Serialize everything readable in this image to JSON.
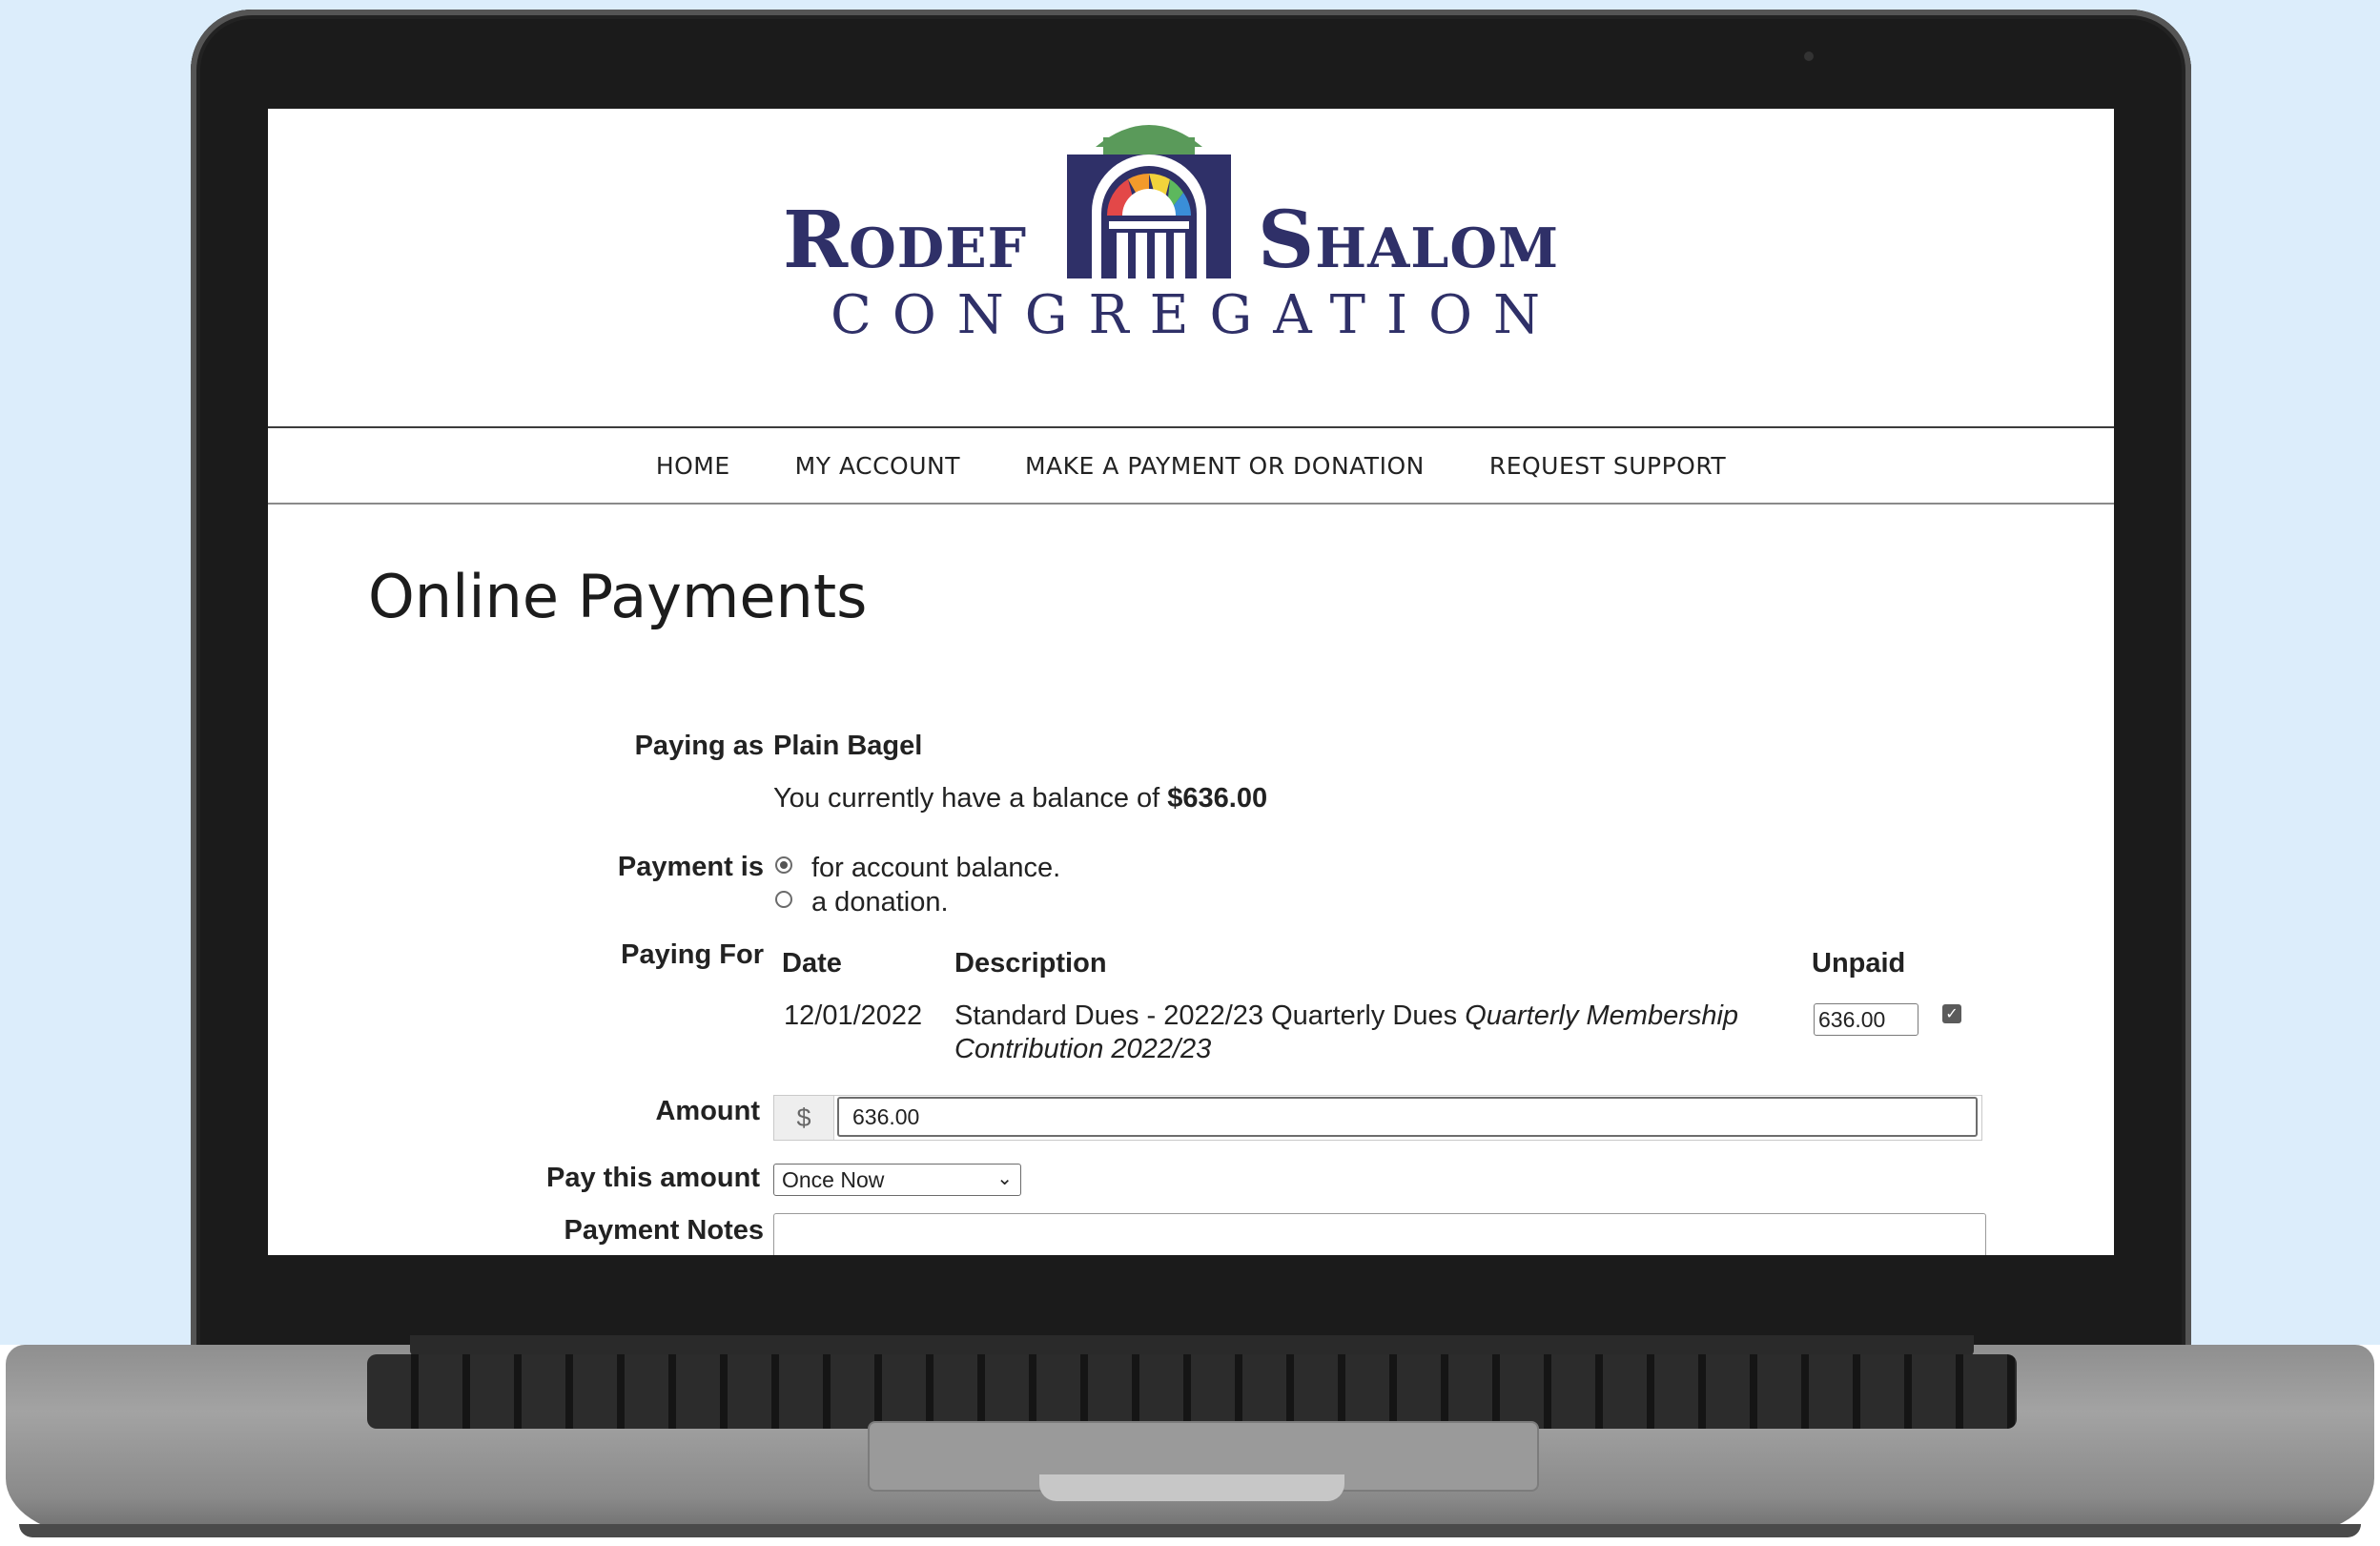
{
  "site": {
    "logo_left": "Rodef",
    "logo_right": "Shalom",
    "logo_sub": "Congregation",
    "colors": {
      "brand_navy": "#2f3068",
      "brand_green": "#5a9a5a"
    }
  },
  "nav": {
    "items": [
      "HOME",
      "MY ACCOUNT",
      "MAKE A PAYMENT OR DONATION",
      "REQUEST SUPPORT"
    ]
  },
  "page": {
    "title": "Online Payments"
  },
  "form": {
    "paying_as_label": "Paying as",
    "paying_as_value": "Plain Bagel",
    "balance_prefix": "You currently have a balance of ",
    "balance_value": "$636.00",
    "payment_is_label": "Payment is",
    "payment_options": [
      "for account balance.",
      "a donation."
    ],
    "selected_payment_option": "for account balance.",
    "paying_for_label": "Paying For",
    "table": {
      "headers": {
        "date": "Date",
        "description": "Description",
        "unpaid": "Unpaid"
      },
      "rows": [
        {
          "date": "12/01/2022",
          "description": "Standard Dues - 2022/23 Quarterly Dues ",
          "description_italic_1": "Quarterly Membership",
          "description_italic_2": "Contribution 2022/23",
          "unpaid": "636.00",
          "checked": true
        }
      ]
    },
    "amount_label": "Amount",
    "amount_prefix": "$",
    "amount_value": "636.00",
    "frequency_label": "Pay this amount",
    "frequency_value": "Once Now",
    "notes_label": "Payment Notes"
  }
}
